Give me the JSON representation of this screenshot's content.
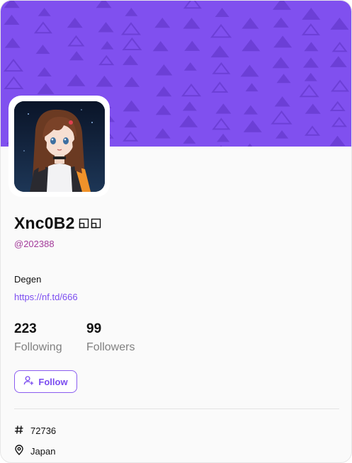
{
  "profile": {
    "display_name": "Xnc0B2",
    "handle": "@202388",
    "bio": "Degen",
    "link": "https://nf.td/666",
    "following_count": "223",
    "following_label": "Following",
    "followers_count": "99",
    "followers_label": "Followers",
    "follow_button_label": "Follow",
    "id_number": "72736",
    "location": "Japan"
  },
  "icons": {
    "name_badges": [
      "square-outline-icon",
      "square-outline-icon"
    ],
    "follow": "user-plus-icon",
    "id": "hash-icon",
    "location": "map-pin-icon"
  },
  "colors": {
    "cover": "#8050ef",
    "accent": "#7b4cf0",
    "handle": "#a33a9a",
    "muted": "#808080"
  }
}
